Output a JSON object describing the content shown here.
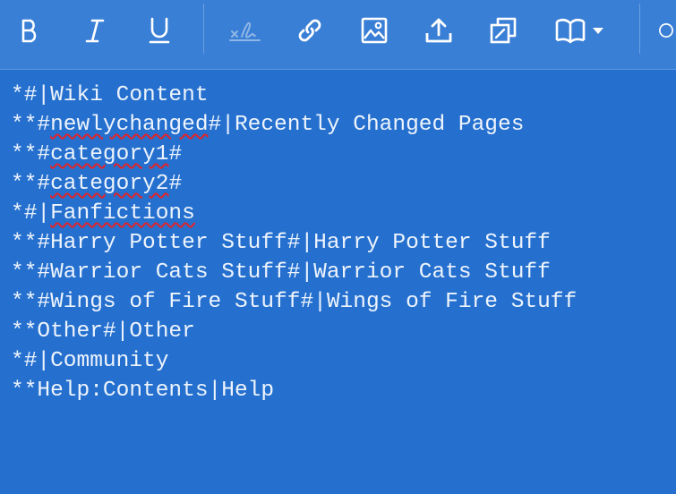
{
  "toolbar": {
    "buttons": [
      {
        "name": "bold-button",
        "icon": "bold-icon",
        "label": "B"
      },
      {
        "name": "italic-button",
        "icon": "italic-icon",
        "label": "I"
      },
      {
        "name": "underline-button",
        "icon": "underline-icon",
        "label": "U"
      },
      {
        "name": "signature-button",
        "icon": "signature-icon",
        "disabled": true
      },
      {
        "name": "link-button",
        "icon": "link-icon"
      },
      {
        "name": "image-button",
        "icon": "image-icon"
      },
      {
        "name": "upload-button",
        "icon": "upload-icon"
      },
      {
        "name": "gallery-button",
        "icon": "gallery-icon"
      },
      {
        "name": "template-dropdown-button",
        "icon": "book-icon"
      }
    ]
  },
  "editor": {
    "lines": [
      [
        {
          "t": "*#|"
        },
        {
          "t": "Wiki Content"
        }
      ],
      [
        {
          "t": "**#"
        },
        {
          "t": "newlychanged",
          "spell": true
        },
        {
          "t": "#|Recently Changed Pages"
        }
      ],
      [
        {
          "t": "**#"
        },
        {
          "t": "category1",
          "spell": true
        },
        {
          "t": "#"
        }
      ],
      [
        {
          "t": "**#"
        },
        {
          "t": "category2",
          "spell": true
        },
        {
          "t": "#"
        }
      ],
      [
        {
          "t": "*#|"
        },
        {
          "t": "Fanfictions",
          "spell": true
        }
      ],
      [
        {
          "t": "**#Harry Potter Stuff#|Harry Potter Stuff"
        }
      ],
      [
        {
          "t": "**#Warrior Cats Stuff#|Warrior Cats Stuff"
        }
      ],
      [
        {
          "t": "**#Wings of Fire Stuff#|Wings of Fire Stuff"
        }
      ],
      [
        {
          "t": "**Other#|Other"
        }
      ],
      [
        {
          "t": "*#|Community"
        }
      ],
      [
        {
          "t": "**Help:Contents|Help"
        }
      ]
    ]
  },
  "colors": {
    "background": "#2570cf",
    "toolbar": "#3a7fd6",
    "text": "#eef4fc",
    "spellcheck": "#e0242a"
  }
}
